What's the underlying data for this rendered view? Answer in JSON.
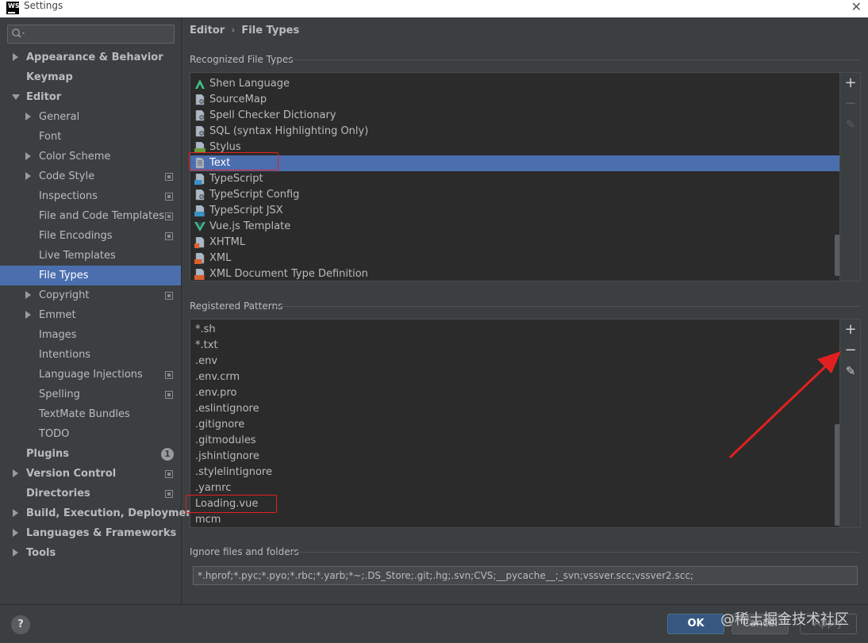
{
  "window": {
    "title": "Settings",
    "logo": "WS"
  },
  "sidebar": {
    "search_placeholder": "",
    "items": [
      {
        "label": "Appearance & Behavior",
        "level": 0,
        "bold": true,
        "arrow": "right"
      },
      {
        "label": "Keymap",
        "level": 0,
        "bold": true,
        "arrow": ""
      },
      {
        "label": "Editor",
        "level": 0,
        "bold": true,
        "arrow": "down"
      },
      {
        "label": "General",
        "level": 1,
        "arrow": "right"
      },
      {
        "label": "Font",
        "level": 1,
        "arrow": ""
      },
      {
        "label": "Color Scheme",
        "level": 1,
        "arrow": "right"
      },
      {
        "label": "Code Style",
        "level": 1,
        "arrow": "right",
        "project": true
      },
      {
        "label": "Inspections",
        "level": 1,
        "arrow": "",
        "project": true
      },
      {
        "label": "File and Code Templates",
        "level": 1,
        "arrow": "",
        "project": true
      },
      {
        "label": "File Encodings",
        "level": 1,
        "arrow": "",
        "project": true
      },
      {
        "label": "Live Templates",
        "level": 1,
        "arrow": ""
      },
      {
        "label": "File Types",
        "level": 1,
        "arrow": "",
        "selected": true
      },
      {
        "label": "Copyright",
        "level": 1,
        "arrow": "right",
        "project": true
      },
      {
        "label": "Emmet",
        "level": 1,
        "arrow": "right"
      },
      {
        "label": "Images",
        "level": 1,
        "arrow": ""
      },
      {
        "label": "Intentions",
        "level": 1,
        "arrow": ""
      },
      {
        "label": "Language Injections",
        "level": 1,
        "arrow": "",
        "project": true
      },
      {
        "label": "Spelling",
        "level": 1,
        "arrow": "",
        "project": true
      },
      {
        "label": "TextMate Bundles",
        "level": 1,
        "arrow": ""
      },
      {
        "label": "TODO",
        "level": 1,
        "arrow": ""
      },
      {
        "label": "Plugins",
        "level": 0,
        "bold": true,
        "arrow": "",
        "badge": "1"
      },
      {
        "label": "Version Control",
        "level": 0,
        "bold": true,
        "arrow": "right",
        "project": true
      },
      {
        "label": "Directories",
        "level": 0,
        "bold": true,
        "arrow": "",
        "project": true
      },
      {
        "label": "Build, Execution, Deployment",
        "level": 0,
        "bold": true,
        "arrow": "right"
      },
      {
        "label": "Languages & Frameworks",
        "level": 0,
        "bold": true,
        "arrow": "right"
      },
      {
        "label": "Tools",
        "level": 0,
        "bold": true,
        "arrow": "right"
      }
    ]
  },
  "breadcrumb": {
    "parent": "Editor",
    "separator": "›",
    "current": "File Types"
  },
  "recognized": {
    "title": "Recognized File Types",
    "items": [
      {
        "label": "Shen Language",
        "icon": "shen-icon",
        "color": "#3fbf8a"
      },
      {
        "label": "SourceMap",
        "icon": "file-gear-icon",
        "color": "#9a9a9a"
      },
      {
        "label": "Spell Checker Dictionary",
        "icon": "dictionary-file-icon",
        "color": "#9a9a9a"
      },
      {
        "label": "SQL (syntax Highlighting Only)",
        "icon": "file-gear-icon",
        "color": "#9a9a9a"
      },
      {
        "label": "Stylus",
        "icon": "stylus-file-icon",
        "color": "#6a9a3a"
      },
      {
        "label": "Text",
        "icon": "text-file-icon",
        "color": "#9a9a9a",
        "selected": true
      },
      {
        "label": "TypeScript",
        "icon": "typescript-file-icon",
        "color": "#3a8fc4"
      },
      {
        "label": "TypeScript Config",
        "icon": "file-gear-icon",
        "color": "#9a9a9a"
      },
      {
        "label": "TypeScript JSX",
        "icon": "tsx-file-icon",
        "color": "#3a8fc4"
      },
      {
        "label": "Vue.js Template",
        "icon": "vue-icon",
        "color": "#41b883"
      },
      {
        "label": "XHTML",
        "icon": "xhtml-file-icon",
        "color": "#d9602f"
      },
      {
        "label": "XML",
        "icon": "xml-file-icon",
        "color": "#d9602f"
      },
      {
        "label": "XML Document Type Definition",
        "icon": "dtd-file-icon",
        "color": "#d9602f"
      }
    ],
    "tools": {
      "add": "+",
      "remove": "−",
      "edit": "✎"
    }
  },
  "patterns": {
    "title": "Registered Patterns",
    "items": [
      "*.sh",
      "*.txt",
      ".env",
      ".env.crm",
      ".env.pro",
      ".eslintignore",
      ".gitignore",
      ".gitmodules",
      ".jshintignore",
      ".stylelintignore",
      ".yarnrc",
      "Loading.vue",
      "mcm"
    ],
    "highlighted": "Loading.vue",
    "tools": {
      "add": "+",
      "remove": "−",
      "edit": "✎"
    }
  },
  "ignore": {
    "title": "Ignore files and folders",
    "value": "*.hprof;*.pyc;*.pyo;*.rbc;*.yarb;*~;.DS_Store;.git;.hg;.svn;CVS;__pycache__;_svn;vssver.scc;vssver2.scc;"
  },
  "footer": {
    "help": "?",
    "ok": "OK",
    "cancel": "Cancel",
    "apply": "Apply",
    "watermark": "@稀土掘金技术社区"
  },
  "colors": {
    "selection": "#4b6eaf",
    "annotation": "#e02020",
    "background": "#3c3f41",
    "list_bg": "#2b2b2b"
  }
}
